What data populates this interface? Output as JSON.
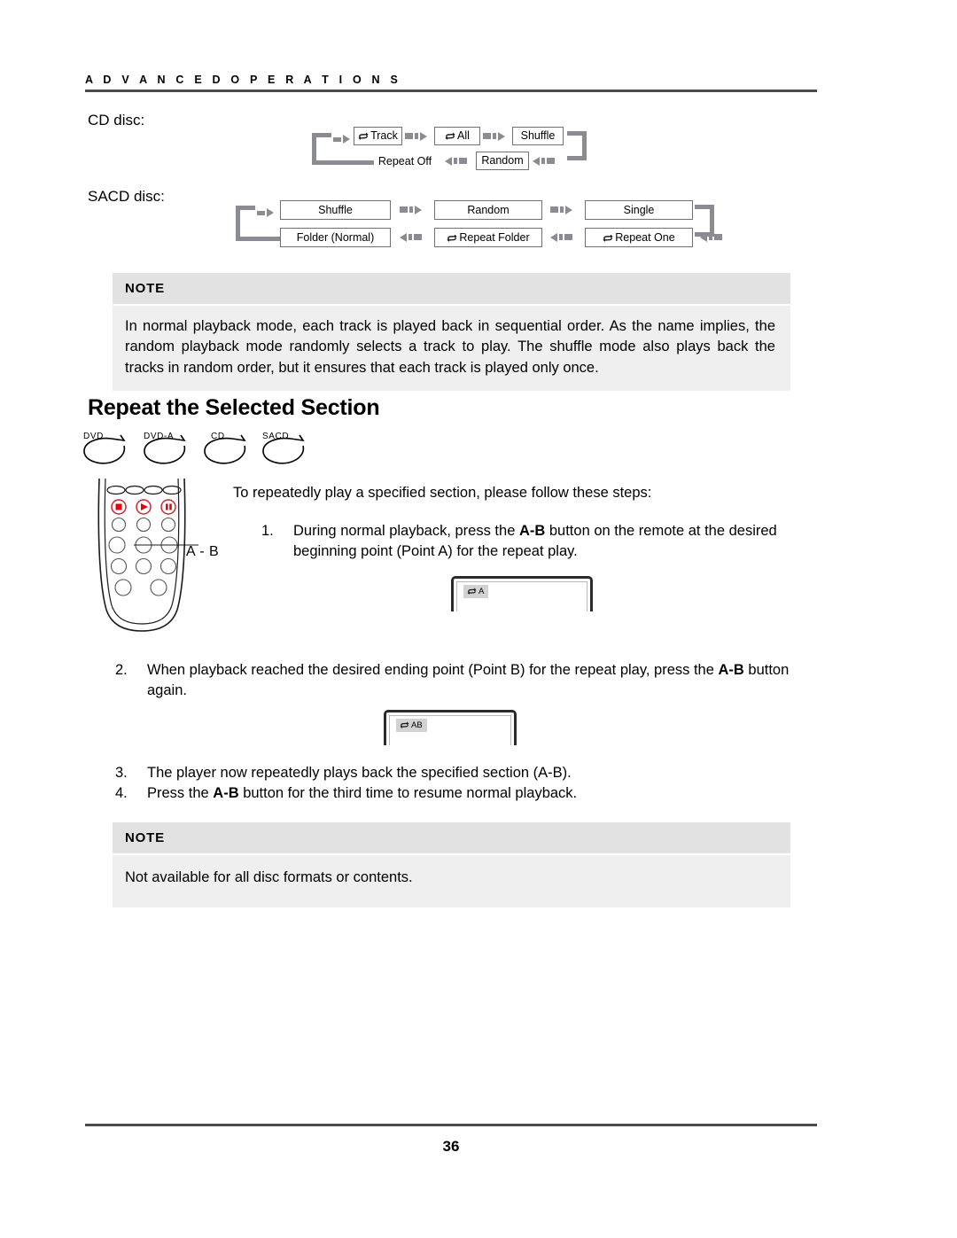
{
  "header": {
    "running_title": "A D V A N C E D   O P E R A T I O N S"
  },
  "labels": {
    "cd_disc": "CD disc:",
    "sacd_disc": "SACD disc:"
  },
  "cd_flow": {
    "top_row": [
      "Track",
      "All",
      "Shuffle"
    ],
    "top_row_icons": [
      "repeat-icon",
      "repeat-icon",
      ""
    ],
    "bottom_row": [
      "Repeat Off",
      "Random"
    ],
    "bottom_row_boxed": [
      false,
      true
    ]
  },
  "sacd_flow": {
    "top_row": [
      "Shuffle",
      "Random",
      "Single"
    ],
    "bottom_row": [
      "Folder (Normal)",
      "Repeat Folder",
      "Repeat One"
    ],
    "bottom_row_icons": [
      "",
      "repeat-icon",
      "repeat-icon"
    ]
  },
  "note_1": {
    "heading": "NOTE",
    "body": "In normal playback mode, each track is played back in sequential order.  As the name implies, the random playback mode randomly selects a track to play.  The shuffle mode also plays back the tracks in random order, but it ensures that each track is played only once."
  },
  "section": {
    "heading": "Repeat the Selected Section"
  },
  "disc_badges": [
    {
      "label": "DVD"
    },
    {
      "label": "DVD-A"
    },
    {
      "label": "CD"
    },
    {
      "label": "SACD"
    }
  ],
  "remote": {
    "callout_label": "A - B"
  },
  "steps": {
    "intro": "To repeatedly play a specified section, please follow these steps:",
    "items": [
      {
        "num": "1.",
        "prefix": "During normal playback, press the ",
        "bold": "A-B",
        "suffix": " button on the remote at the desired beginning point (Point A) for the repeat play."
      },
      {
        "num": "2.",
        "prefix": "When playback reached the desired ending point (Point B) for the repeat play, press the ",
        "bold": "A-B",
        "suffix": " button again."
      },
      {
        "num": "3.",
        "prefix": "The player now repeatedly plays back the specified section (A-B).",
        "bold": "",
        "suffix": ""
      },
      {
        "num": "4.",
        "prefix": "Press the ",
        "bold": "A-B",
        "suffix": " button for the third time to resume normal playback."
      }
    ]
  },
  "osd_screens": [
    {
      "badge_text": "A",
      "icon": "repeat-icon"
    },
    {
      "badge_text": "AB",
      "icon": "repeat-icon"
    }
  ],
  "note_2": {
    "heading": "NOTE",
    "body": "Not available for all disc formats or contents."
  },
  "footer": {
    "page_number": "36"
  },
  "colors": {
    "connector_gray": "#8b8b93",
    "box_border": "#6f6f78",
    "note_head_bg": "#e2e2e2",
    "note_body_bg": "#efefef",
    "rule": "#4a4a4a",
    "remote_accent": "#e8000d"
  }
}
